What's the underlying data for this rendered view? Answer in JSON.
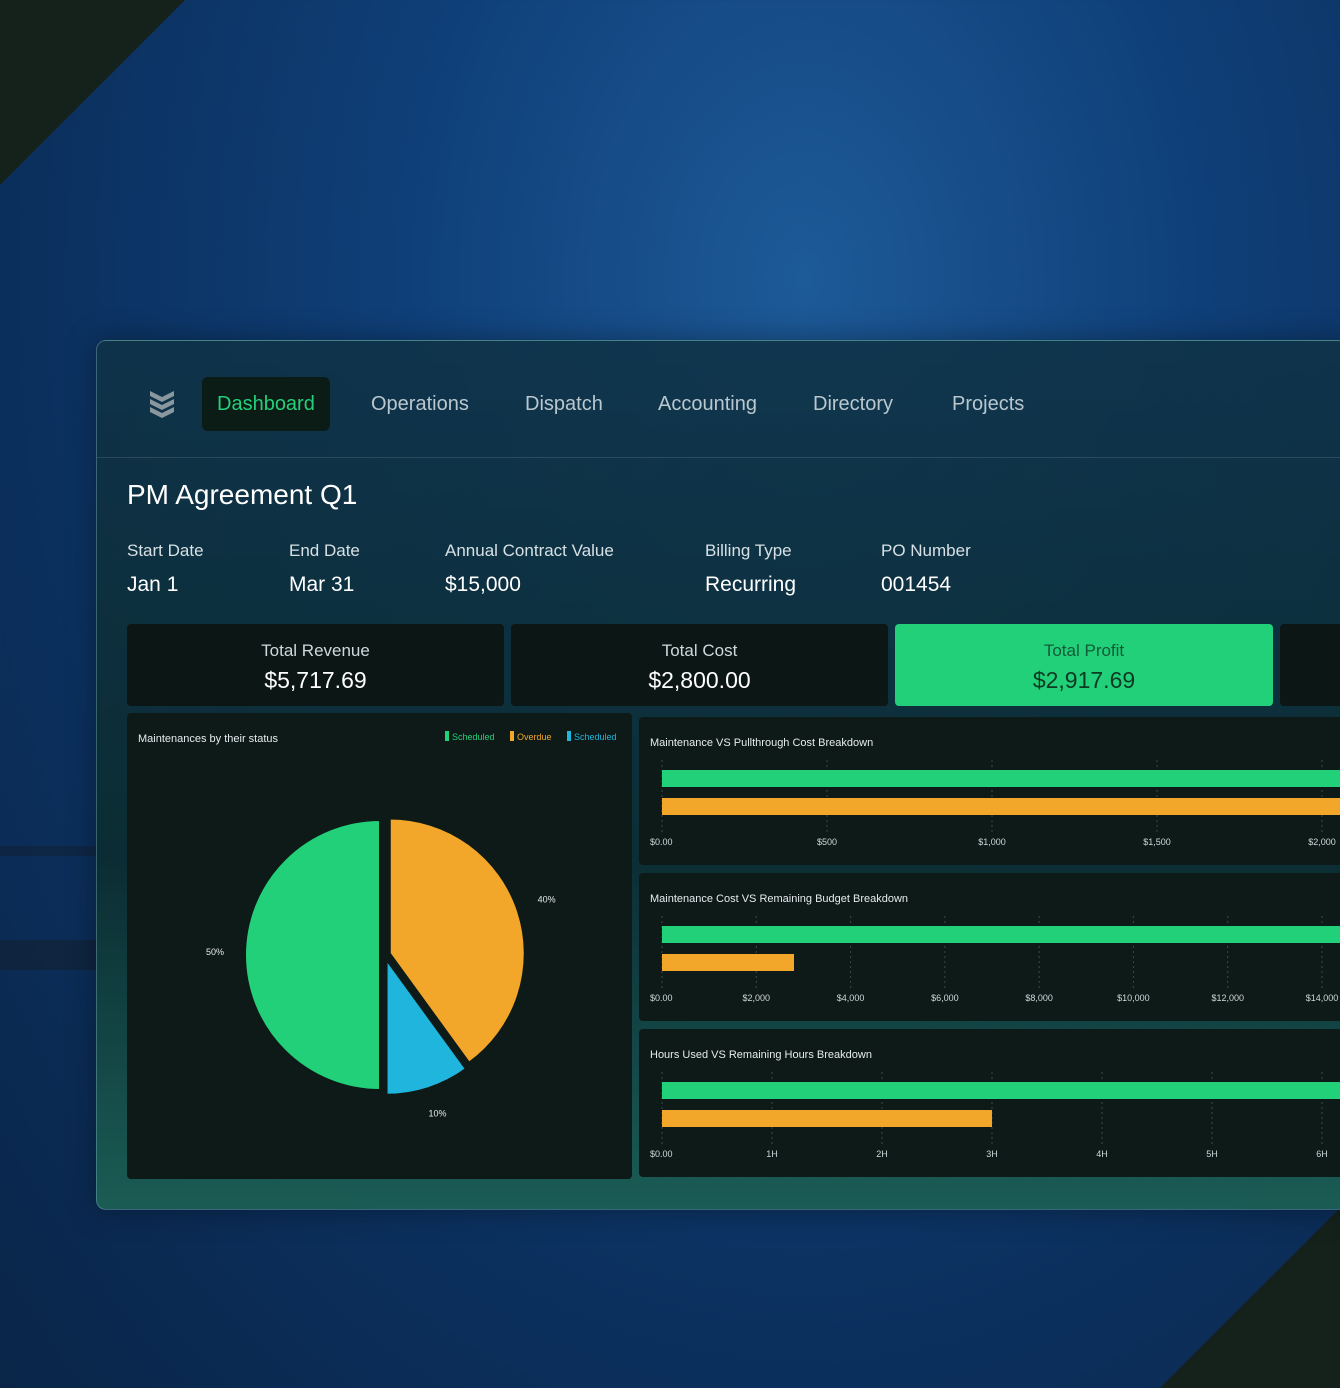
{
  "nav": {
    "items": [
      {
        "label": "Dashboard",
        "active": true
      },
      {
        "label": "Operations",
        "active": false
      },
      {
        "label": "Dispatch",
        "active": false
      },
      {
        "label": "Accounting",
        "active": false
      },
      {
        "label": "Directory",
        "active": false
      },
      {
        "label": "Projects",
        "active": false
      }
    ],
    "logo_icon": "stacked-chevrons-icon"
  },
  "page": {
    "title": "PM Agreement Q1"
  },
  "meta": [
    {
      "label": "Start Date",
      "value": "Jan 1"
    },
    {
      "label": "End Date",
      "value": "Mar 31"
    },
    {
      "label": "Annual Contract Value",
      "value": "$15,000"
    },
    {
      "label": "Billing Type",
      "value": "Recurring"
    },
    {
      "label": "PO Number",
      "value": "001454"
    }
  ],
  "cards": [
    {
      "label": "Total Revenue",
      "value": "$5,717.69"
    },
    {
      "label": "Total Cost",
      "value": "$2,800.00"
    },
    {
      "label": "Total Profit",
      "value": "$2,917.69"
    }
  ],
  "colors": {
    "green": "#23d07a",
    "orange": "#f2a62a",
    "blue": "#1fb5dd",
    "accent": "#24d07a"
  },
  "chart_data": [
    {
      "type": "pie",
      "title": "Maintenances by their status",
      "legend": [
        {
          "name": "Scheduled",
          "color": "#23d07a"
        },
        {
          "name": "Overdue",
          "color": "#f2a62a"
        },
        {
          "name": "Scheduled",
          "color": "#1fb5dd"
        }
      ],
      "legend_position": "top-right",
      "slices": [
        {
          "label": "50%",
          "value": 50,
          "color": "#23d07a"
        },
        {
          "label": "40%",
          "value": 40,
          "color": "#f2a62a"
        },
        {
          "label": "10%",
          "value": 10,
          "color": "#1fb5dd"
        }
      ]
    },
    {
      "type": "bar",
      "orientation": "horizontal",
      "title": "Maintenance VS Pullthrough Cost Breakdown",
      "ticks": [
        "$0.00",
        "$500",
        "$1,000",
        "$1,500",
        "$2,000"
      ],
      "xlim": [
        0,
        2000
      ],
      "values": [
        2300,
        2300
      ],
      "colors": [
        "#23d07a",
        "#f2a62a"
      ]
    },
    {
      "type": "bar",
      "orientation": "horizontal",
      "title": "Maintenance Cost VS Remaining Budget Breakdown",
      "ticks": [
        "$0.00",
        "$2,000",
        "$4,000",
        "$6,000",
        "$8,000",
        "$10,000",
        "$12,000",
        "$14,000"
      ],
      "xlim": [
        0,
        14000
      ],
      "values": [
        15000,
        2800
      ],
      "colors": [
        "#23d07a",
        "#f2a62a"
      ]
    },
    {
      "type": "bar",
      "orientation": "horizontal",
      "title": "Hours Used VS Remaining Hours Breakdown",
      "ticks": [
        "$0.00",
        "1H",
        "2H",
        "3H",
        "4H",
        "5H",
        "6H"
      ],
      "xlim": [
        0,
        6
      ],
      "values": [
        7.5,
        3
      ],
      "colors": [
        "#23d07a",
        "#f2a62a"
      ]
    }
  ]
}
